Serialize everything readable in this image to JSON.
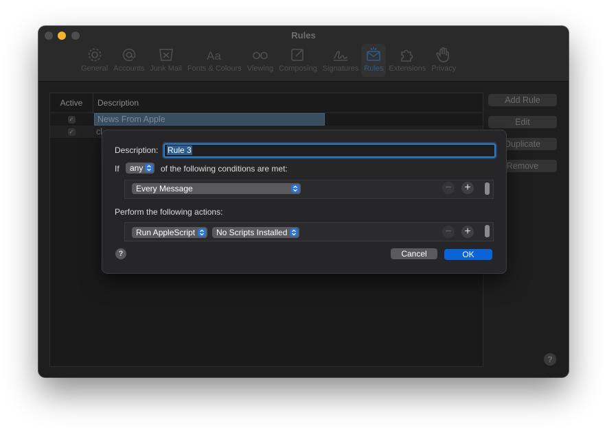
{
  "window": {
    "title": "Rules"
  },
  "toolbar": {
    "items": [
      {
        "label": "General",
        "icon": "gear-icon"
      },
      {
        "label": "Accounts",
        "icon": "at-icon"
      },
      {
        "label": "Junk Mail",
        "icon": "junk-bin-icon"
      },
      {
        "label": "Fonts & Colours",
        "icon": "font-icon"
      },
      {
        "label": "Viewing",
        "icon": "glasses-icon"
      },
      {
        "label": "Composing",
        "icon": "compose-icon"
      },
      {
        "label": "Signatures",
        "icon": "signature-icon"
      },
      {
        "label": "Rules",
        "icon": "rules-envelope-icon",
        "selected": true
      },
      {
        "label": "Extensions",
        "icon": "puzzle-icon"
      },
      {
        "label": "Privacy",
        "icon": "hand-icon"
      }
    ]
  },
  "rules_table": {
    "col_active": "Active",
    "col_description": "Description",
    "rows": [
      {
        "active": true,
        "description": "News From Apple"
      },
      {
        "active": true,
        "description": "cl"
      }
    ]
  },
  "side_buttons": {
    "add": "Add Rule",
    "edit": "Edit",
    "duplicate": "Duplicate",
    "remove": "Remove"
  },
  "sheet": {
    "description_label": "Description:",
    "description_value": "Rule 3",
    "if_label": "If",
    "match_value": "any",
    "conditions_suffix": "of the following conditions are met:",
    "condition_value": "Every Message",
    "actions_label": "Perform the following actions:",
    "action_value": "Run AppleScript",
    "script_value": "No Scripts Installed",
    "cancel": "Cancel",
    "ok": "OK",
    "help": "?",
    "minus": "−",
    "plus": "+"
  },
  "help_glyph": "?",
  "colors": {
    "accent": "#0a64d8",
    "focus_ring": "#2f7fc6",
    "traffic_min": "#f5b430"
  }
}
